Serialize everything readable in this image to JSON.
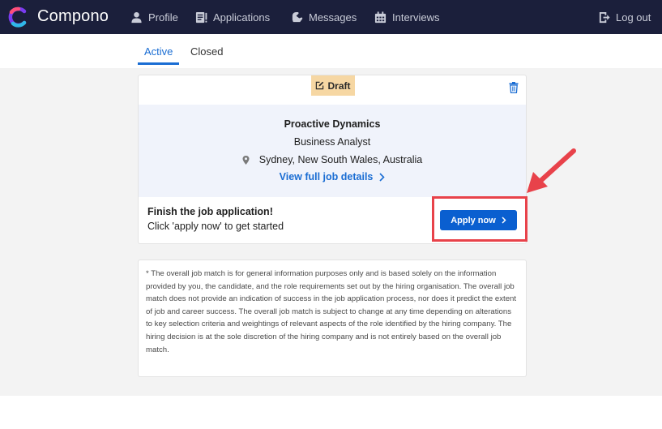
{
  "brand": {
    "name": "Compono",
    "colors": {
      "navbar": "#1b1f3b",
      "accent": "#1a6dd3",
      "draft": "#f6d7a3",
      "highlight": "#e8424a"
    }
  },
  "nav": {
    "items": [
      {
        "label": "Profile",
        "icon": "person-icon"
      },
      {
        "label": "Applications",
        "icon": "applications-icon"
      },
      {
        "label": "Messages",
        "icon": "messages-icon"
      },
      {
        "label": "Interviews",
        "icon": "calendar-icon"
      }
    ],
    "logout": {
      "label": "Log out",
      "icon": "logout-icon"
    }
  },
  "tabs": [
    {
      "label": "Active",
      "active": true
    },
    {
      "label": "Closed",
      "active": false
    }
  ],
  "job": {
    "status": "Draft",
    "company": "Proactive Dynamics",
    "role": "Business Analyst",
    "location": "Sydney, New South Wales, Australia",
    "view_details": "View full job details",
    "finish_title": "Finish the job application!",
    "finish_subtitle": "Click 'apply now' to get started",
    "apply_label": "Apply now"
  },
  "disclaimer": "* The overall job match is for general information purposes only and is based solely on the information provided by you, the candidate, and the role requirements set out by the hiring organisation. The overall job match does not provide an indication of success in the job application process, nor does it predict the extent of job and career success. The overall job match is subject to change at any time depending on alterations to key selection criteria and weightings of relevant aspects of the role identified by the hiring company. The hiring decision is at the sole discretion of the hiring company and is not entirely based on the overall job match."
}
